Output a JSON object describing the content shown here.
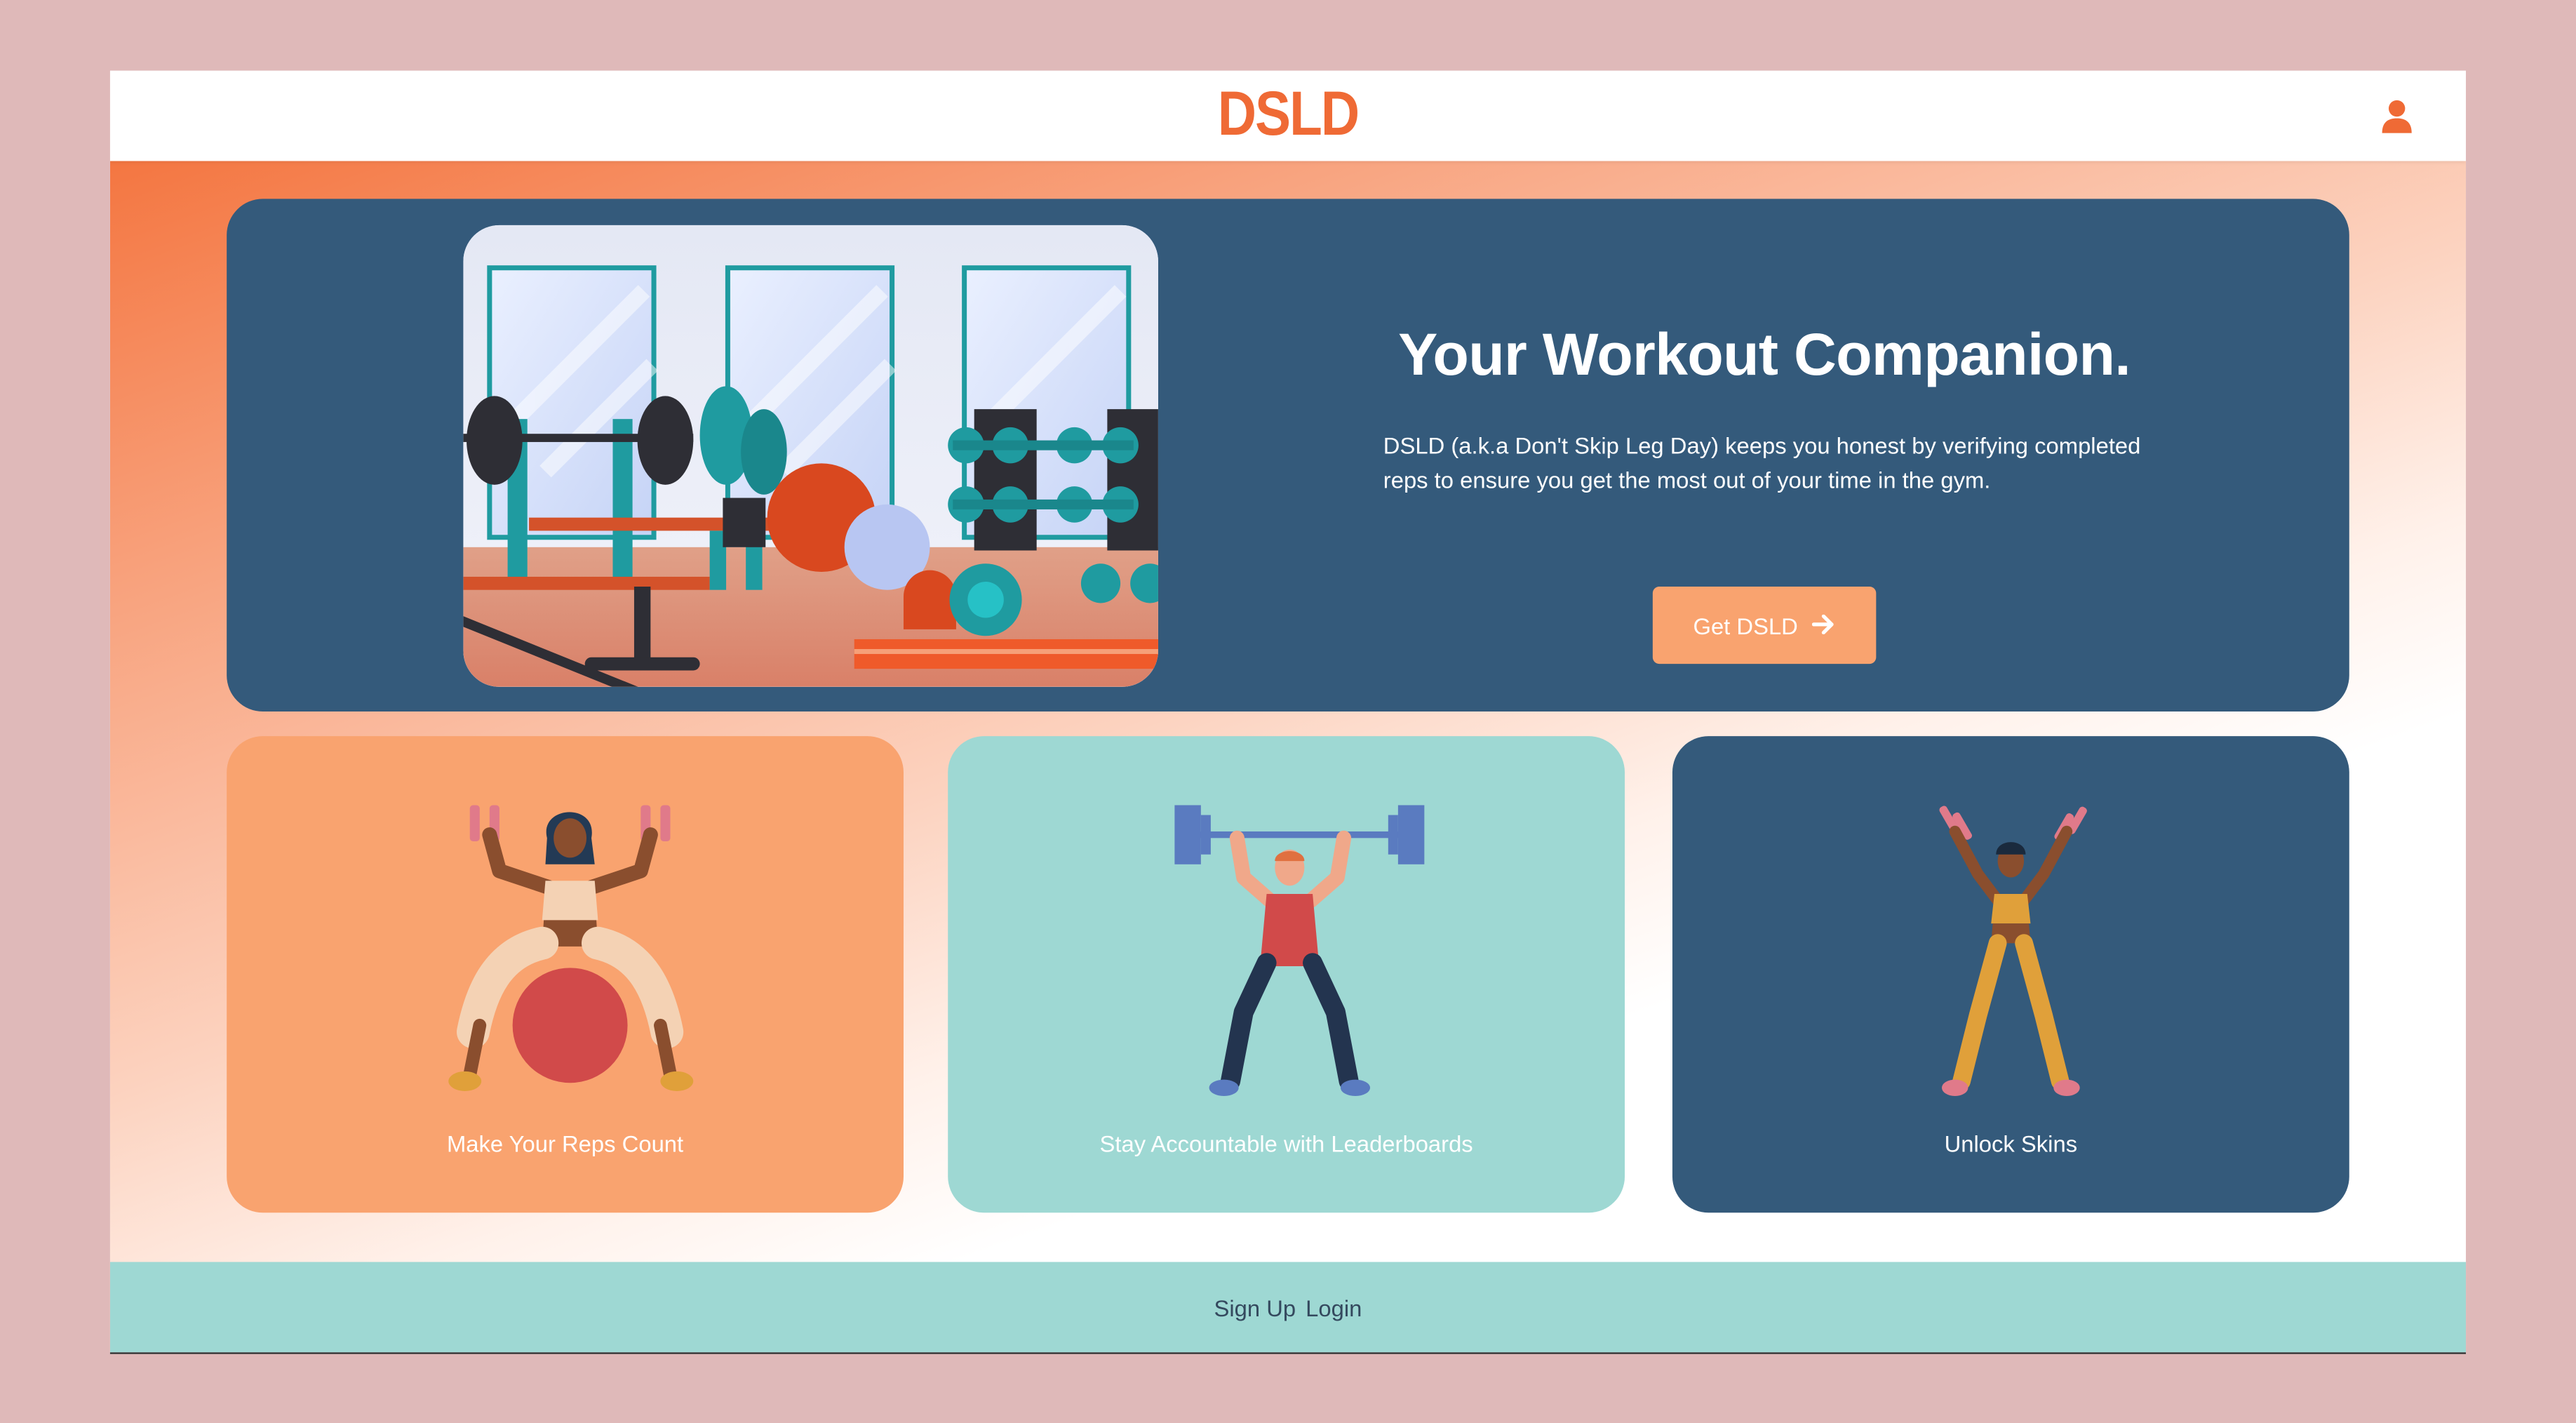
{
  "header": {
    "logo_text": "DSLD",
    "user_icon": "user-icon"
  },
  "hero": {
    "title": "Your Workout Companion.",
    "description": "DSLD (a.k.a Don't Skip Leg Day) keeps you honest by verifying completed reps to ensure you get the most out of your time in the gym.",
    "cta_label": "Get DSLD",
    "cta_icon": "arrow-right-icon",
    "image": "gym-illustration"
  },
  "features": [
    {
      "label": "Make Your Reps Count",
      "image": "woman-exercise-ball-dumbbells"
    },
    {
      "label": "Stay Accountable with Leaderboards",
      "image": "man-overhead-barbell"
    },
    {
      "label": "Unlock Skins",
      "image": "woman-dumbbells-raised"
    }
  ],
  "footer": {
    "signup_label": "Sign Up",
    "login_label": "Login"
  },
  "colors": {
    "accent": "#ef6a35",
    "navy": "#345a7b",
    "peach": "#f9a36f",
    "mint": "#9ed8d3"
  }
}
